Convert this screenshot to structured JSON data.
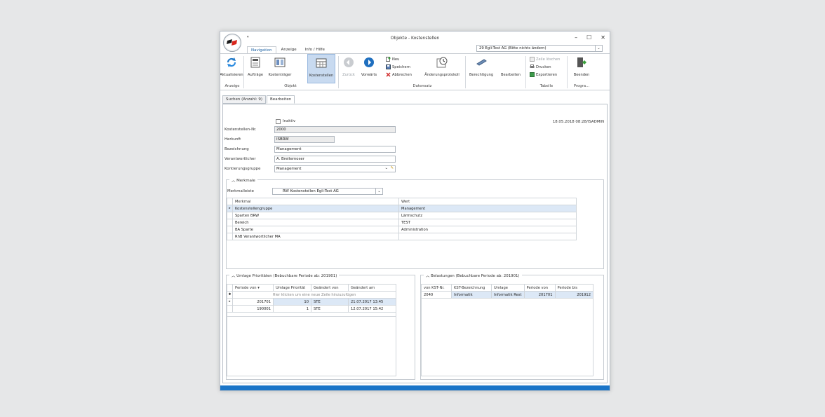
{
  "window": {
    "title": "Objekte - Kostenstellen",
    "minimize": "–",
    "maximize": "☐",
    "close": "✕",
    "qa": "▾"
  },
  "company_combo": {
    "value": "29 Egli-Test AG (Bitte nichts ändern)",
    "arrow": "⌄"
  },
  "ribbon_tabs": [
    "Navigation",
    "Anzeige",
    "Info / Hilfe"
  ],
  "ribbon": {
    "aktualisieren": "Aktualisieren",
    "auftraege": "Aufträge",
    "kostentraeger": "Kostenträger",
    "kostenstellen": "Kostenstellen",
    "zurueck": "Zurück",
    "vorwaerts": "Vorwärts",
    "neu": "Neu",
    "speichern": "Speichern",
    "abbrechen": "Abbrechen",
    "aenderungsprotokoll": "Änderungsprotokoll",
    "berechtigung": "Berechtigung",
    "bearbeiten": "Bearbeiten",
    "zeile_loeschen": "Zeile löschen",
    "drucken": "Drucken",
    "exportieren": "Exportieren",
    "beenden": "Beenden",
    "groups": {
      "anzeige": "Anzeige",
      "objekt": "Objekt",
      "datensatz": "Datensatz",
      "tabelle": "Tabelle",
      "programm": "Progra..."
    }
  },
  "page_tabs": [
    "Suchen (Anzahl: 9)",
    "Bearbeiten"
  ],
  "form": {
    "inaktiv_label": "Inaktiv",
    "timestamp": "18.05.2018 08:28/ISADMIN",
    "kostenstellen_nr_label": "Kostenstellen-Nr.",
    "kostenstellen_nr": "2000",
    "herkunft_label": "Herkunft",
    "herkunft": "ISBRW",
    "bezeichnung_label": "Bezeichnung",
    "bezeichnung": "Management",
    "verantwortlicher_label": "Verantwortlicher",
    "verantwortlicher": "A. Breitemoser",
    "kontierungsgruppe_label": "Kontierungsgruppe",
    "kontierungsgruppe": "Management",
    "dropdown_arrow": "⌄",
    "edit_icon": "✎"
  },
  "merkmale": {
    "title": "Merkmale",
    "collapse": "︿",
    "leiste_label": "Merkmalleiste",
    "leiste_value": "RW Kostenstellen Egli-Test AG",
    "headers": [
      "Merkmal",
      "Wert"
    ],
    "rows": [
      [
        "Kostenstellengruppe",
        "Management"
      ],
      [
        "Sparten BRW",
        "Lärmschutz"
      ],
      [
        "Bereich",
        "TEST"
      ],
      [
        "BA Sparte",
        "Administration"
      ],
      [
        "RhB Verantwortlicher MA",
        ""
      ]
    ]
  },
  "umlage": {
    "title": "Umlage Prioritäten (Bebuchbare Periode ab: 201901)",
    "headers": [
      "Periode von",
      "Umlage Priorität",
      "Geändert von",
      "Geändert am"
    ],
    "new_row": "Hier klicken um eine neue Zeile hinzuzufügen",
    "rows": [
      [
        "201701",
        "10",
        "STE",
        "21.07.2017 13:45"
      ],
      [
        "190001",
        "1",
        "STE",
        "12.07.2017 15:42"
      ]
    ]
  },
  "belastungen": {
    "title": "Belastungen (Bebuchbare Periode ab: 201901)",
    "headers": [
      "von KST-Nr.",
      "KST-Bezeichnung",
      "Umlage",
      "Periode von",
      "Periode bis"
    ],
    "rows": [
      [
        "2040",
        "Informatik",
        "Informatik Rest",
        "201701",
        "201912"
      ]
    ]
  },
  "icons": {
    "row_pointer": "▸",
    "new_row": "✱",
    "sort": "▾"
  }
}
